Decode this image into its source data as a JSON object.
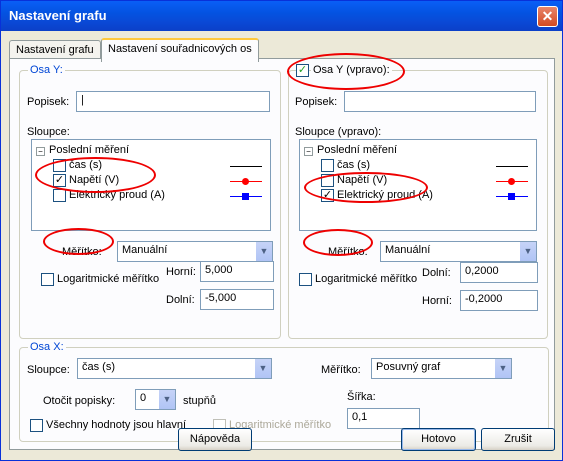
{
  "window": {
    "title": "Nastavení grafu",
    "close": "✕"
  },
  "tabs": [
    {
      "label": "Nastavení grafu"
    },
    {
      "label": "Nastavení souřadnicových os"
    }
  ],
  "y_axis": {
    "legend": "Osa Y:",
    "popisek_label": "Popisek:",
    "popisek_value": "|",
    "sloupce_label": "Sloupce:",
    "tree_root": "Poslední měření",
    "items": [
      {
        "label": "čas (s)",
        "checked": false
      },
      {
        "label": "Napětí (V)",
        "checked": true
      },
      {
        "label": "Elektrický proud (A)",
        "checked": false
      }
    ],
    "meritko_label": "Měřítko:",
    "meritko_value": "Manuální",
    "log_label": "Logaritmické měřítko",
    "horni_label": "Horní:",
    "horni_value": "5,000",
    "dolni_label": "Dolní:",
    "dolni_value": "-5,000"
  },
  "y_right_axis": {
    "legend": "Osa Y (vpravo):",
    "enabled": true,
    "popisek_label": "Popisek:",
    "popisek_value": "",
    "sloupce_label": "Sloupce (vpravo):",
    "tree_root": "Poslední měření",
    "items": [
      {
        "label": "čas (s)",
        "checked": false
      },
      {
        "label": "Napětí (V)",
        "checked": false
      },
      {
        "label": "Elektrický proud (A)",
        "checked": true
      }
    ],
    "meritko_label": "Měřítko:",
    "meritko_value": "Manuální",
    "log_label": "Logaritmické měřítko",
    "dolni_label": "Dolní:",
    "dolni_value": "0,2000",
    "horni_label": "Horní:",
    "horni_value": "-0,2000"
  },
  "x_axis": {
    "legend": "Osa X:",
    "sloupce_label": "Sloupce:",
    "sloupce_value": "čas (s)",
    "meritko_label": "Měřítko:",
    "meritko_value": "Posuvný graf",
    "otocit_label": "Otočit popisky:",
    "otocit_value": "0",
    "stupnu_label": "stupňů",
    "sirka_label": "Šířka:",
    "sirka_value": "0,1",
    "vsechny_label": "Všechny hodnoty jsou hlavní",
    "log_label": "Logaritmické měřítko"
  },
  "buttons": {
    "help": "Nápověda",
    "ok": "Hotovo",
    "cancel": "Zrušit"
  },
  "colors": {
    "annotation": "#e00000",
    "series_red": "#ff0000",
    "series_blue": "#0000ff",
    "accent": "#0046d5"
  }
}
